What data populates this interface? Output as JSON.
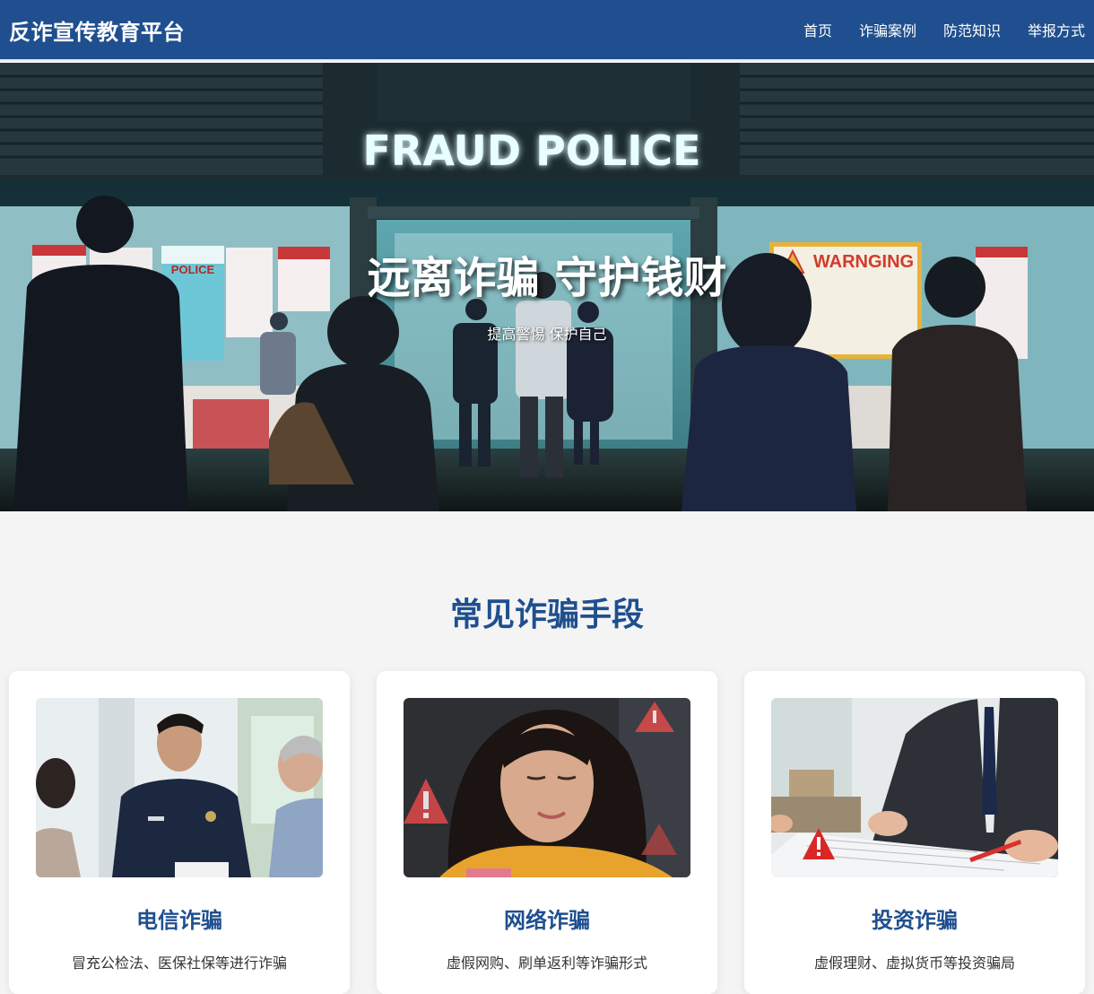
{
  "header": {
    "brand": "反诈宣传教育平台",
    "nav": [
      "首页",
      "诈骗案例",
      "防范知识",
      "举报方式"
    ]
  },
  "hero": {
    "title": "远离诈骗 守护钱财",
    "subtitle": "提高警惕 保护自己",
    "sign_text": "FRAUD POLICE",
    "poster_left": "POLICE",
    "poster_right": "WARNGING"
  },
  "section": {
    "title": "常见诈骗手段",
    "cards": [
      {
        "title": "电信诈骗",
        "desc": "冒充公检法、医保社保等进行诈骗"
      },
      {
        "title": "网络诈骗",
        "desc": "虚假网购、刷单返利等诈骗形式"
      },
      {
        "title": "投资诈骗",
        "desc": "虚假理财、虚拟货币等投资骗局"
      }
    ]
  },
  "colors": {
    "primary": "#1f4f8f",
    "background": "#f4f4f4",
    "card": "#ffffff",
    "warning": "#e02020"
  }
}
